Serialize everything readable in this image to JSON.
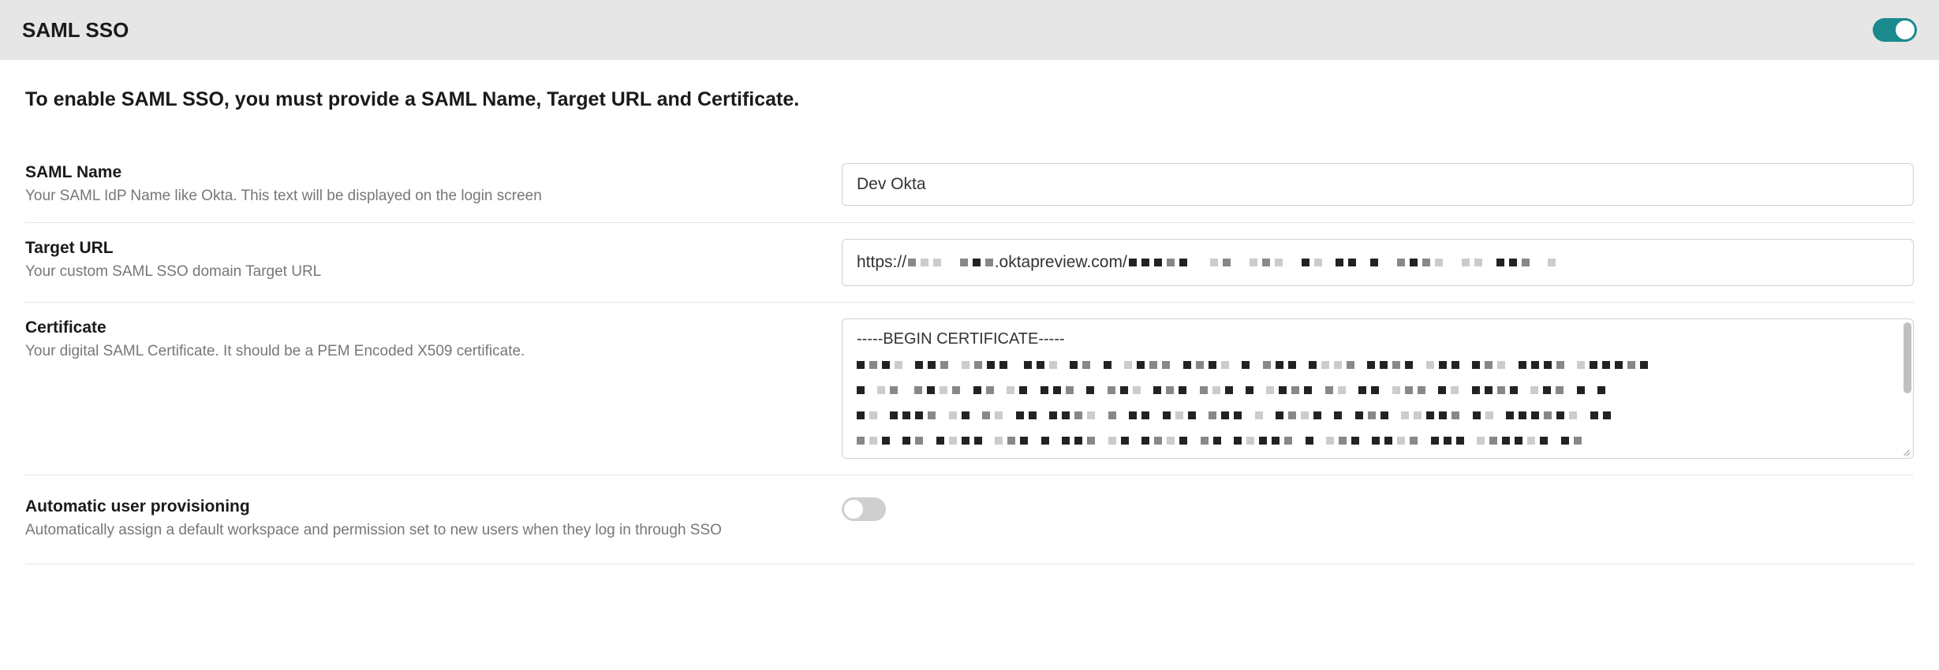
{
  "header": {
    "title": "SAML SSO",
    "enabled": true
  },
  "instruction": "To enable SAML SSO, you must provide a SAML Name, Target URL and Certificate.",
  "fields": {
    "samlName": {
      "label": "SAML Name",
      "help": "Your SAML IdP Name like Okta. This text will be displayed on the login screen",
      "value": "Dev Okta"
    },
    "targetUrl": {
      "label": "Target URL",
      "help": "Your custom SAML SSO domain Target URL",
      "value_prefix": "https://",
      "value_mid": ".oktapreview.com/"
    },
    "certificate": {
      "label": "Certificate",
      "help": "Your digital SAML Certificate. It should be a PEM Encoded X509 certificate.",
      "value_header": "-----BEGIN CERTIFICATE-----"
    },
    "autoProvisioning": {
      "label": "Automatic user provisioning",
      "help": "Automatically assign a default workspace and permission set to new users when they log in through SSO",
      "enabled": false
    }
  }
}
